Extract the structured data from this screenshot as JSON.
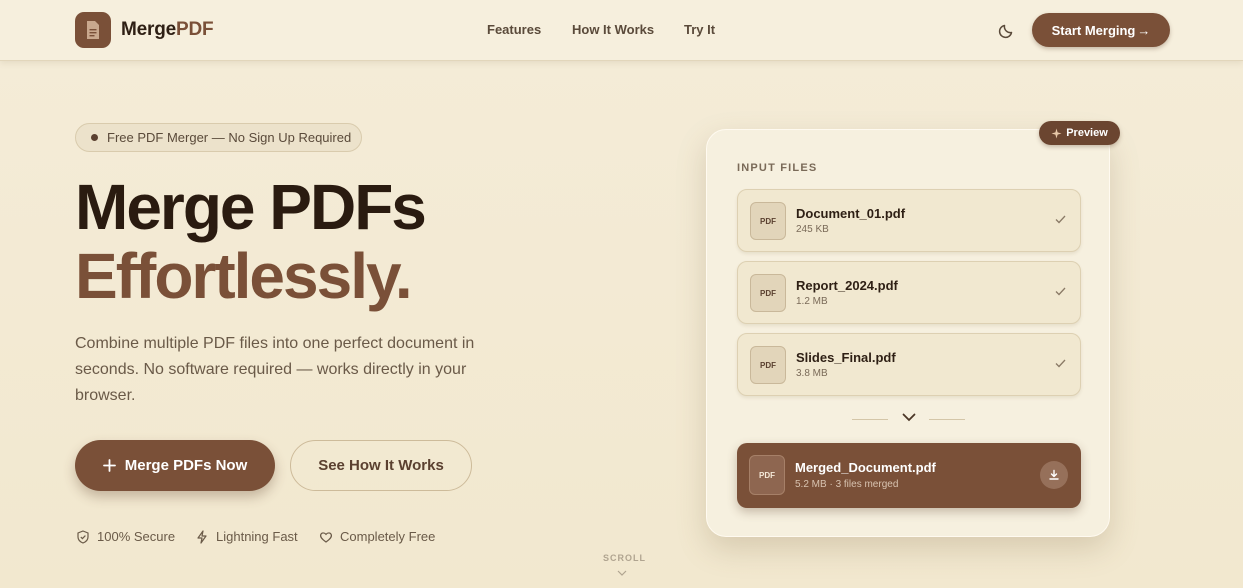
{
  "header": {
    "brand_part1": "Merge",
    "brand_part2": "PDF",
    "nav": [
      "Features",
      "How It Works",
      "Try It"
    ],
    "cta_label": "Start Merging",
    "cta_arrow": "→"
  },
  "hero": {
    "badge": "Free PDF Merger — No Sign Up Required",
    "title_line1": "Merge PDFs",
    "title_line2": "Effortlessly.",
    "subtitle": "Combine multiple PDF files into one perfect document in seconds. No software required — works directly in your browser.",
    "primary_button": "Merge PDFs Now",
    "secondary_button": "See How It Works",
    "features": [
      "100% Secure",
      "Lightning Fast",
      "Completely Free"
    ],
    "scroll_label": "SCROLL"
  },
  "preview_card": {
    "pill_label": "Preview",
    "input_label": "INPUT FILES",
    "pdf_tag": "PDF",
    "files": [
      {
        "name": "Document_01.pdf",
        "size": "245 KB"
      },
      {
        "name": "Report_2024.pdf",
        "size": "1.2 MB"
      },
      {
        "name": "Slides_Final.pdf",
        "size": "3.8 MB"
      }
    ],
    "output": {
      "name": "Merged_Document.pdf",
      "meta": "5.2 MB · 3 files merged"
    }
  },
  "icons": {
    "logo": "document-icon",
    "theme": "moon-icon",
    "feature_icons": [
      "shield-icon",
      "lightning-icon",
      "heart-icon"
    ],
    "file_status": "check-icon",
    "download": "download-icon"
  },
  "colors": {
    "accent": "#7a5038",
    "background": "#f2e8cf",
    "text_dark": "#2a1b10"
  }
}
